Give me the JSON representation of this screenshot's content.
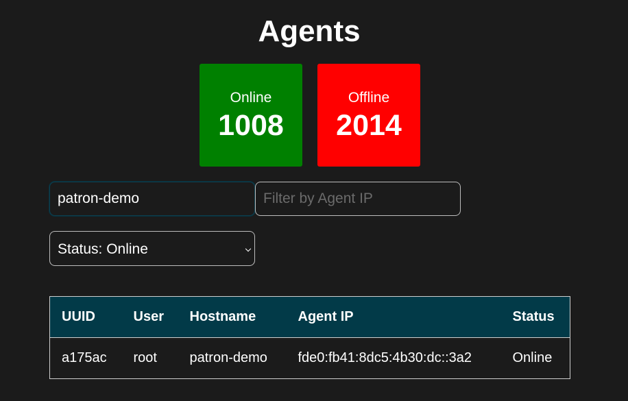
{
  "page": {
    "title": "Agents"
  },
  "stats": {
    "online": {
      "label": "Online",
      "count": "1008",
      "color": "#008000"
    },
    "offline": {
      "label": "Offline",
      "count": "2014",
      "color": "#ff0000"
    }
  },
  "filters": {
    "hostname": {
      "value": "patron-demo",
      "placeholder": ""
    },
    "agent_ip": {
      "value": "",
      "placeholder": "Filter by Agent IP"
    },
    "status": {
      "selected": "Status: Online",
      "icon": "chevron-down-icon"
    }
  },
  "table": {
    "columns": [
      "UUID",
      "User",
      "Hostname",
      "Agent IP",
      "Status"
    ],
    "rows": [
      [
        "a175ac",
        "root",
        "patron-demo",
        "fde0:fb41:8dc5:4b30:dc::3a2",
        "Online"
      ]
    ],
    "header_color": "#023a48"
  }
}
